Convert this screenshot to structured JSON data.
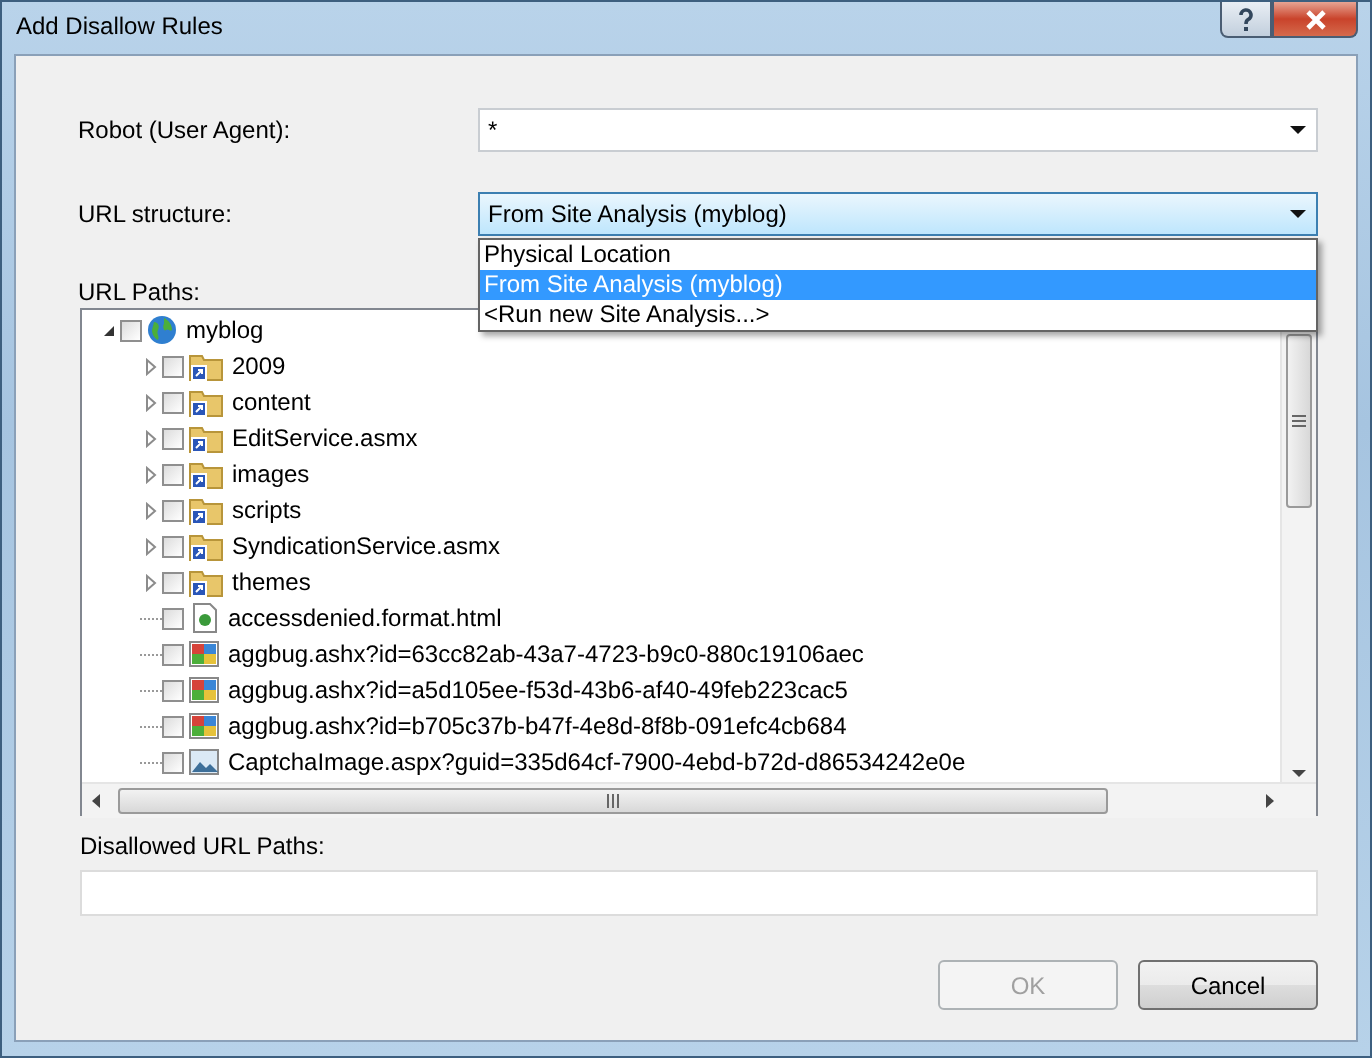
{
  "window": {
    "title": "Add Disallow Rules"
  },
  "robot": {
    "label": "Robot (User Agent):",
    "value": "*"
  },
  "url_structure": {
    "label": "URL structure:",
    "value": "From Site Analysis (myblog)",
    "expanded": true,
    "options": [
      {
        "label": "Physical Location",
        "selected": false
      },
      {
        "label": "From Site Analysis (myblog)",
        "selected": true
      },
      {
        "label": "<Run new Site Analysis...>",
        "selected": false
      }
    ]
  },
  "url_paths": {
    "label": "URL Paths:",
    "tree": [
      {
        "label": "myblog",
        "kind": "site",
        "checked": false,
        "expanded": true,
        "children": [
          {
            "label": "2009",
            "kind": "folder",
            "checked": false,
            "expanded": false
          },
          {
            "label": "content",
            "kind": "folder",
            "checked": false,
            "expanded": false
          },
          {
            "label": "EditService.asmx",
            "kind": "folder",
            "checked": false,
            "expanded": false
          },
          {
            "label": "images",
            "kind": "folder",
            "checked": false,
            "expanded": false
          },
          {
            "label": "scripts",
            "kind": "folder",
            "checked": false,
            "expanded": false
          },
          {
            "label": "SyndicationService.asmx",
            "kind": "folder",
            "checked": false,
            "expanded": false
          },
          {
            "label": "themes",
            "kind": "folder",
            "checked": false,
            "expanded": false
          },
          {
            "label": "accessdenied.format.html",
            "kind": "page",
            "checked": false
          },
          {
            "label": "aggbug.ashx?id=63cc82ab-43a7-4723-b9c0-880c19106aec",
            "kind": "image",
            "checked": false
          },
          {
            "label": "aggbug.ashx?id=a5d105ee-f53d-43b6-af40-49feb223cac5",
            "kind": "image",
            "checked": false
          },
          {
            "label": "aggbug.ashx?id=b705c37b-b47f-4e8d-8f8b-091efc4cb684",
            "kind": "image",
            "checked": false
          },
          {
            "label": "CaptchaImage.aspx?guid=335d64cf-7900-4ebd-b72d-d86534242e0e",
            "kind": "picture-file",
            "checked": false
          }
        ]
      }
    ]
  },
  "disallowed": {
    "label": "Disallowed URL Paths:"
  },
  "buttons": [
    {
      "label": "OK",
      "disabled": true
    },
    {
      "label": "Cancel",
      "disabled": false
    }
  ]
}
